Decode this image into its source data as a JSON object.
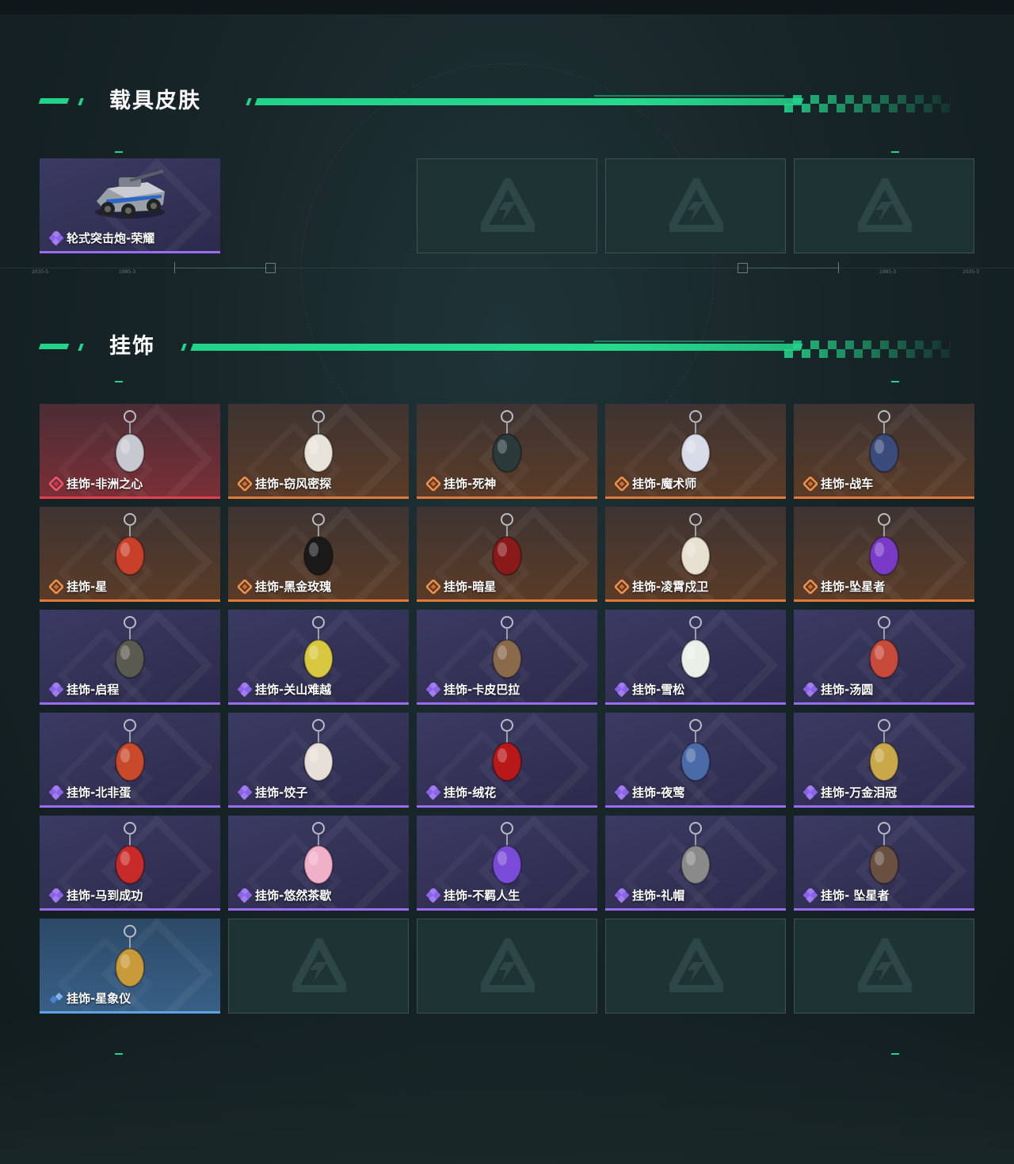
{
  "sections": {
    "vehicle": {
      "title": "载具皮肤",
      "items": [
        {
          "name": "轮式突击炮-荣耀",
          "rarity": "purple",
          "icon": "armored-car-icon"
        }
      ],
      "empty_slots": 3
    },
    "pendant": {
      "title": "挂饰",
      "items": [
        {
          "name": "挂饰-非洲之心",
          "rarity": "red",
          "icon": "white-crystal-pendant-icon"
        },
        {
          "name": "挂饰-窃风密探",
          "rarity": "orange",
          "icon": "figure-pendant-icon"
        },
        {
          "name": "挂饰-死神",
          "rarity": "orange",
          "icon": "reaper-card-pendant-icon"
        },
        {
          "name": "挂饰-魔术师",
          "rarity": "orange",
          "icon": "magician-card-pendant-icon"
        },
        {
          "name": "挂饰-战车",
          "rarity": "orange",
          "icon": "chariot-card-pendant-icon"
        },
        {
          "name": "挂饰-星",
          "rarity": "orange",
          "icon": "star-card-pendant-icon"
        },
        {
          "name": "挂饰-黑金玫瑰",
          "rarity": "orange",
          "icon": "black-gold-rose-pendant-icon"
        },
        {
          "name": "挂饰-暗星",
          "rarity": "orange",
          "icon": "dark-star-pendant-icon"
        },
        {
          "name": "挂饰-凌霄戍卫",
          "rarity": "orange",
          "icon": "guard-pendant-icon"
        },
        {
          "name": "挂饰-坠星者",
          "rarity": "orange",
          "icon": "purple-crystal-pendant-icon"
        },
        {
          "name": "挂饰-启程",
          "rarity": "purple",
          "icon": "emblem-pendant-icon"
        },
        {
          "name": "挂饰-关山难越",
          "rarity": "purple",
          "icon": "yellow-cylinder-pendant-icon"
        },
        {
          "name": "挂饰-卡皮巴拉",
          "rarity": "purple",
          "icon": "capybara-pendant-icon"
        },
        {
          "name": "挂饰-雪松",
          "rarity": "purple",
          "icon": "snow-pine-pendant-icon"
        },
        {
          "name": "挂饰-汤圆",
          "rarity": "purple",
          "icon": "rice-ball-bowl-pendant-icon"
        },
        {
          "name": "挂饰-北非蛋",
          "rarity": "purple",
          "icon": "shakshuka-pendant-icon"
        },
        {
          "name": "挂饰-饺子",
          "rarity": "purple",
          "icon": "dumpling-plate-pendant-icon"
        },
        {
          "name": "挂饰-绒花",
          "rarity": "purple",
          "icon": "red-flower-pendant-icon"
        },
        {
          "name": "挂饰-夜莺",
          "rarity": "purple",
          "icon": "feather-pendant-icon"
        },
        {
          "name": "挂饰-万金泪冠",
          "rarity": "purple",
          "icon": "crown-pendant-icon"
        },
        {
          "name": "挂饰-马到成功",
          "rarity": "purple",
          "icon": "red-horse-pendant-icon"
        },
        {
          "name": "挂饰-悠然茶歇",
          "rarity": "purple",
          "icon": "cupcake-pendant-icon"
        },
        {
          "name": "挂饰-不羁人生",
          "rarity": "purple",
          "icon": "purple-sneaker-pendant-icon"
        },
        {
          "name": "挂饰-礼帽",
          "rarity": "purple",
          "icon": "fedora-hat-pendant-icon"
        },
        {
          "name": "挂饰- 坠星者",
          "rarity": "purple",
          "icon": "triangle-emblem-pendant-icon"
        },
        {
          "name": "挂饰-星象仪",
          "rarity": "blue",
          "icon": "astrolabe-pendant-icon"
        }
      ],
      "empty_slots": 4
    }
  },
  "colors": {
    "accent": "#22d38a",
    "rarity_red": "#e2404f",
    "rarity_orange": "#e07a3a",
    "rarity_purple": "#9a6cf0",
    "rarity_blue": "#5fa3e6",
    "empty_slot_bg": "#1d3334"
  },
  "hud_labels": [
    "2035-5",
    "1985-3",
    "1985-3",
    "2035-5"
  ]
}
